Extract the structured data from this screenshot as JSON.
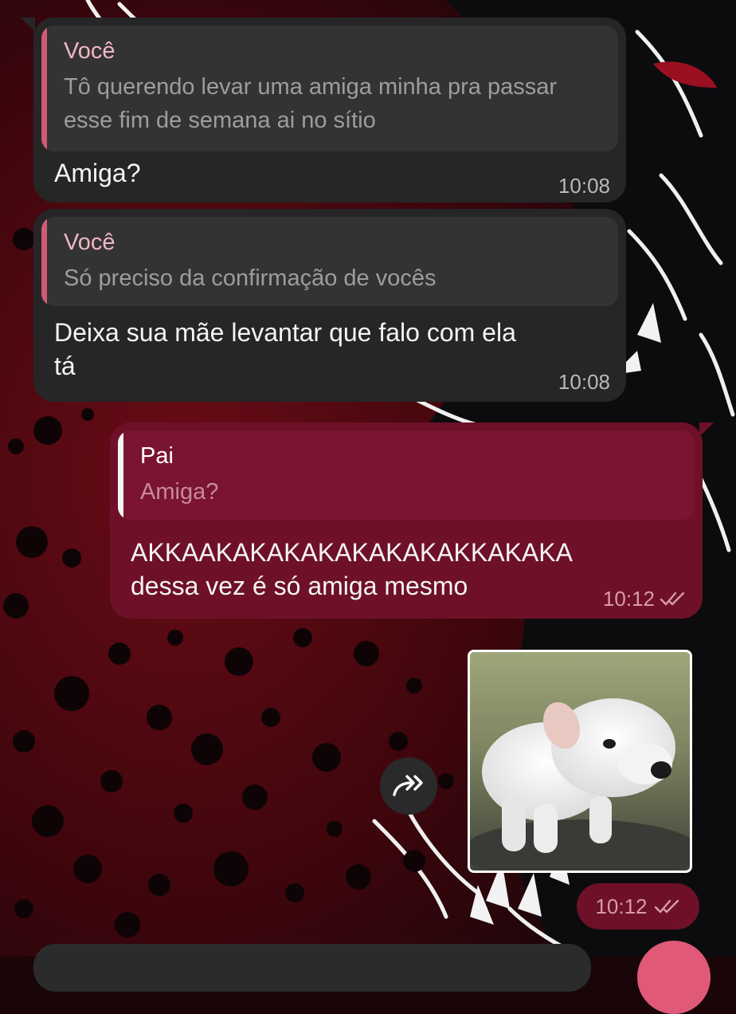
{
  "colors": {
    "incoming_bubble": "#262626",
    "outgoing_bubble": "#6e1128",
    "incoming_reply_accent": "#d15a74",
    "outgoing_reply_accent": "#f4f4f4",
    "text": "#f4f4f4"
  },
  "messages": [
    {
      "direction": "incoming",
      "reply": {
        "name": "Você",
        "text": "Tô querendo levar uma amiga minha pra passar esse fim de semana ai no sítio"
      },
      "text": "Amiga?",
      "time": "10:08"
    },
    {
      "direction": "incoming",
      "reply": {
        "name": "Você",
        "text": "Só preciso da confirmação de vocês"
      },
      "text": "Deixa sua mãe levantar que falo com ela\ntá",
      "time": "10:08"
    },
    {
      "direction": "outgoing",
      "reply": {
        "name": "Pai",
        "text": "Amiga?"
      },
      "text": "AKKAAKAKAKAKAKAKAKAKKAKAKA\ndessa vez é só amiga mesmo",
      "time": "10:12",
      "status_icon": "double-check-icon"
    },
    {
      "direction": "outgoing",
      "media": "puppy-photo",
      "share_icon": "forward-share-icon",
      "time": "10:12",
      "status_icon": "double-check-icon"
    }
  ]
}
